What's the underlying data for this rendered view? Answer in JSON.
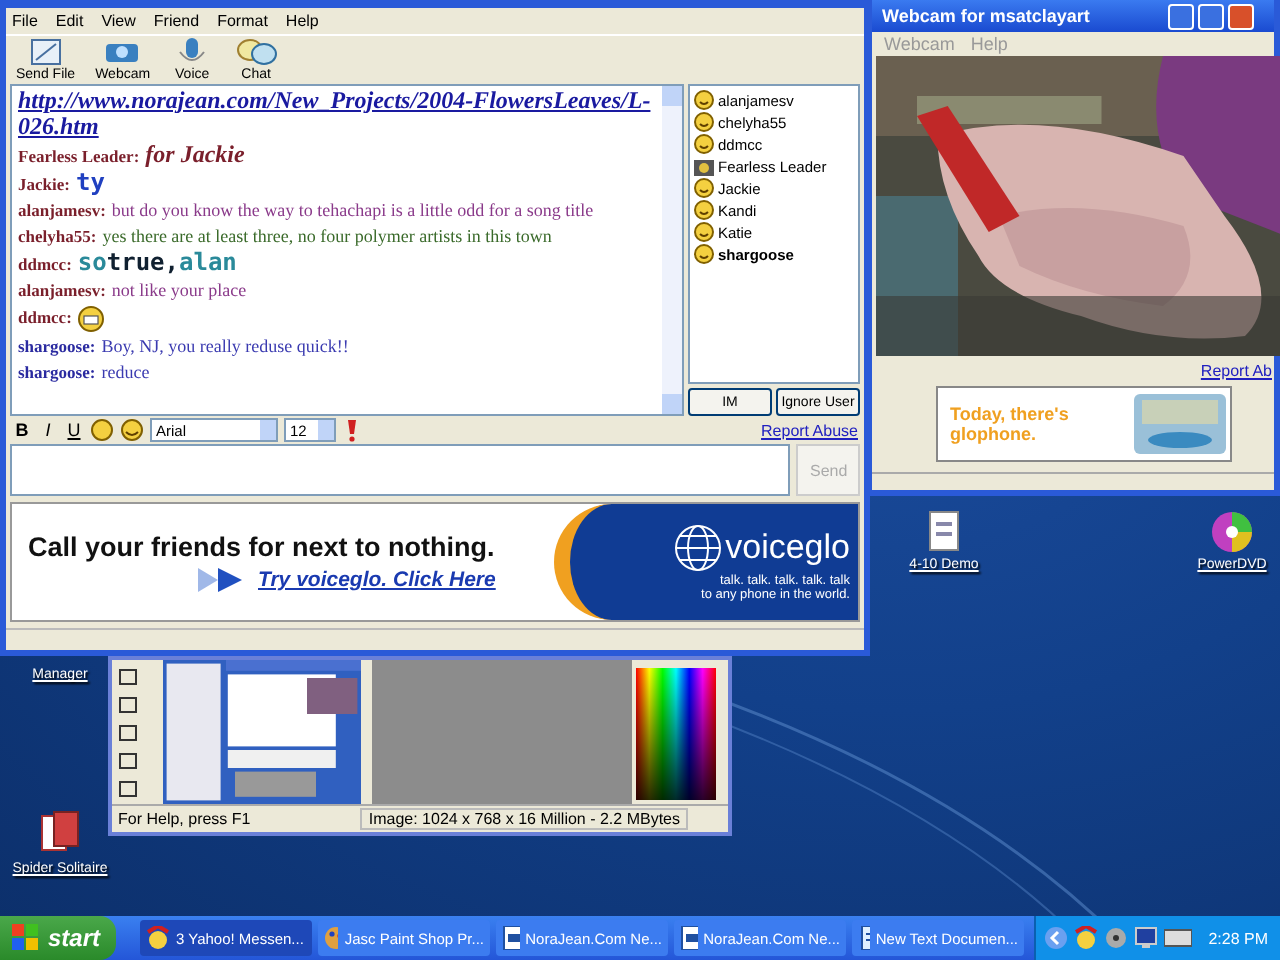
{
  "chat_window": {
    "menu": [
      "File",
      "Edit",
      "View",
      "Friend",
      "Format",
      "Help"
    ],
    "toolbar": [
      {
        "label": "Send File"
      },
      {
        "label": "Webcam"
      },
      {
        "label": "Voice"
      },
      {
        "label": "Chat"
      }
    ],
    "messages": [
      {
        "kind": "link",
        "text": "http://www.norajean.com/New_Projects/2004-FlowersLeaves/L-026.htm",
        "color": "#1a1aa0"
      },
      {
        "kind": "script",
        "sender": "Fearless Leader:",
        "own": false,
        "text": "for Jackie",
        "color": "#7a1f2b"
      },
      {
        "kind": "large",
        "sender": "Jackie:",
        "own": false,
        "text": "ty",
        "color": "#2040c0"
      },
      {
        "kind": "plain",
        "sender": "alanjamesv:",
        "own": false,
        "text": "but do you know the way to tehachapi is a little odd for a song title",
        "color": "#8a3a8a"
      },
      {
        "kind": "plain",
        "sender": "chelyha55:",
        "own": false,
        "text": "yes there are at least three, no four polymer artists in this town",
        "color": "#3a6a2a"
      },
      {
        "kind": "large",
        "sender": "ddmcc:",
        "own": false,
        "parts": [
          {
            "text": "so",
            "color": "#2a8a9a"
          },
          {
            "text": "true,",
            "color": "#102030"
          },
          {
            "text": "alan",
            "color": "#2a8a9a"
          }
        ]
      },
      {
        "kind": "plain",
        "sender": "alanjamesv:",
        "own": false,
        "text": "not like your place",
        "color": "#8a3a8a"
      },
      {
        "kind": "emoji",
        "sender": "ddmcc:",
        "own": false
      },
      {
        "kind": "plain",
        "sender": "shargoose:",
        "own": true,
        "text": "Boy, NJ, you really reduse quick!!",
        "color": "#3a3ab0"
      },
      {
        "kind": "plain",
        "sender": "shargoose:",
        "own": true,
        "text": "reduce",
        "color": "#3a3ab0"
      }
    ],
    "users": [
      {
        "name": "alanjamesv",
        "kind": "smiley",
        "self": false
      },
      {
        "name": "chelyha55",
        "kind": "smiley",
        "self": false
      },
      {
        "name": "ddmcc",
        "kind": "smiley",
        "self": false
      },
      {
        "name": "Fearless Leader",
        "kind": "webcam",
        "self": false
      },
      {
        "name": "Jackie",
        "kind": "smiley",
        "self": false
      },
      {
        "name": "Kandi",
        "kind": "smiley",
        "self": false
      },
      {
        "name": "Katie",
        "kind": "smiley",
        "self": false
      },
      {
        "name": "shargoose",
        "kind": "smiley",
        "self": true
      }
    ],
    "user_buttons": [
      "IM",
      "Ignore User"
    ],
    "format_bar": {
      "buttons": [
        "B",
        "I",
        "U"
      ],
      "font": "Arial",
      "size": "12"
    },
    "report_abuse": "Report Abuse",
    "send_button": {
      "label": "Send",
      "disabled": true
    },
    "ad": {
      "headline": "Call your friends for next to nothing.",
      "link": "Try voiceglo. Click Here",
      "brand": "voiceglo",
      "tagline": "talk. talk. talk. talk. talk",
      "tagline_2": "to any phone in the world."
    }
  },
  "webcam_window": {
    "title": "Webcam for msatclayart",
    "menu": [
      "Webcam",
      "Help"
    ],
    "report_link": "Report Ab",
    "ad": {
      "text": "Today, there's glophone."
    }
  },
  "paint_window": {
    "status_help": "For Help, press F1",
    "status_image": "Image:  1024 x 768 x 16 Million - 2.2 MBytes"
  },
  "desktop_icons": [
    {
      "label": "Manager",
      "kind": "network"
    },
    {
      "label": "4-10 Demo",
      "kind": "document"
    },
    {
      "label": "PowerDVD",
      "kind": "dvd"
    },
    {
      "label": "Spider Solitaire",
      "kind": "cards"
    }
  ],
  "taskbar": {
    "start": "start",
    "tasks": [
      {
        "label": "3 Yahoo! Messen...",
        "kind": "yahoo",
        "selected": true
      },
      {
        "label": "Jasc Paint Shop Pr...",
        "kind": "paint",
        "selected": false
      },
      {
        "label": "NoraJean.Com Ne...",
        "kind": "document",
        "selected": false
      },
      {
        "label": "NoraJean.Com Ne...",
        "kind": "document",
        "selected": false
      },
      {
        "label": "New Text Documen...",
        "kind": "text",
        "selected": false
      }
    ],
    "clock": "2:28 PM"
  }
}
